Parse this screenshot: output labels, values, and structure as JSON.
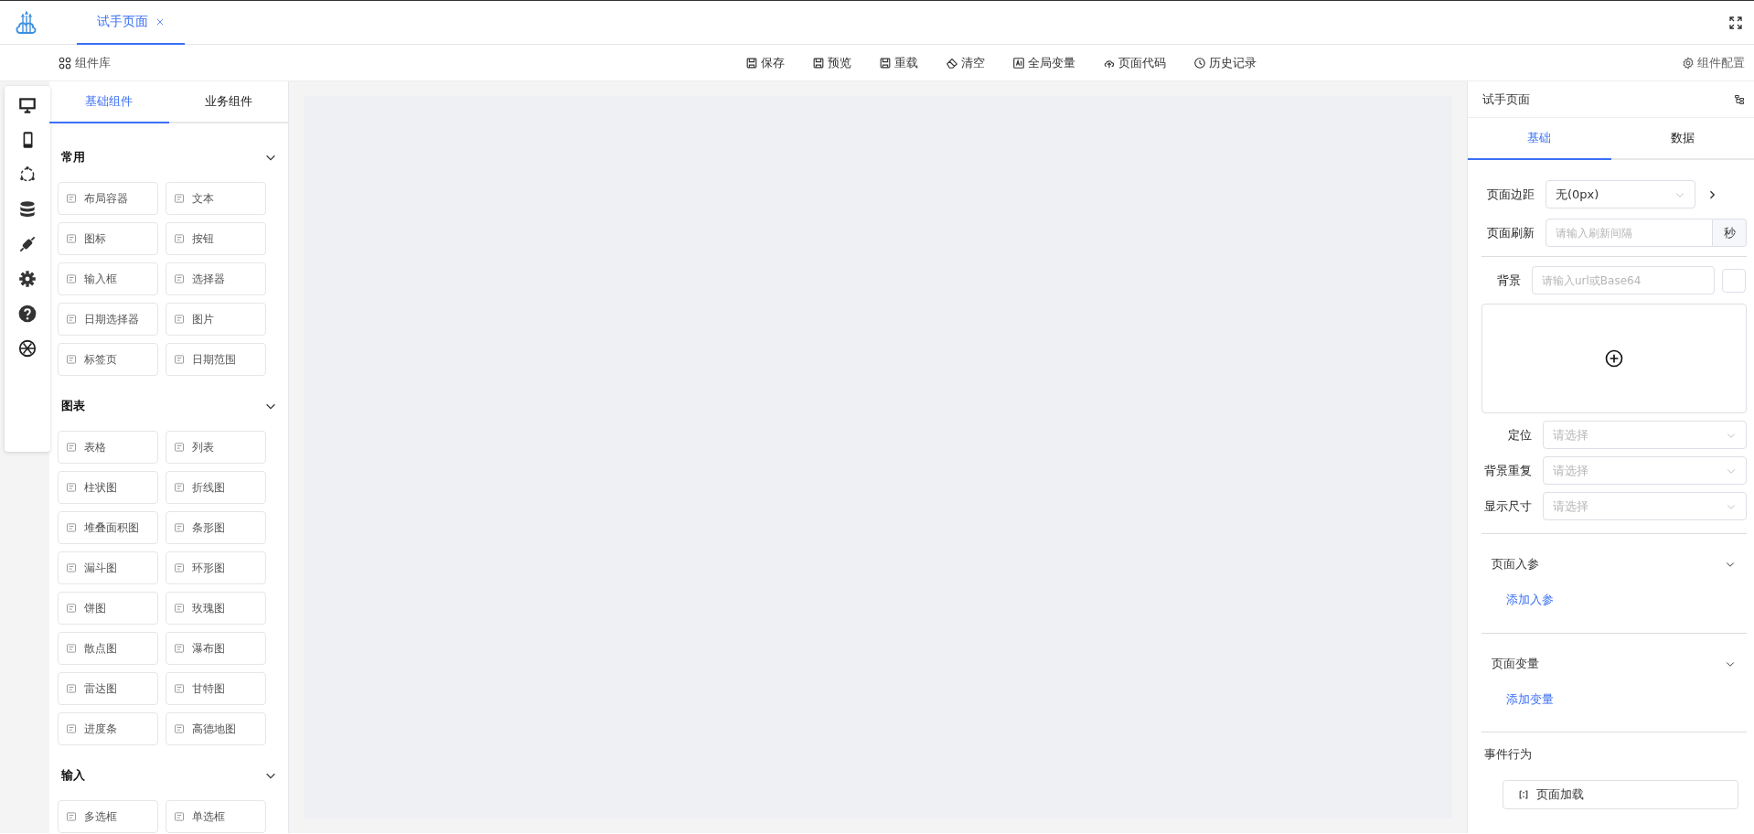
{
  "app_tabs": [
    {
      "label": "试手页面",
      "selected": true,
      "closable": true
    }
  ],
  "toolbar": {
    "library_label": "组件库",
    "actions": [
      {
        "label": "保存",
        "kind": "save"
      },
      {
        "label": "预览",
        "kind": "save"
      },
      {
        "label": "重载",
        "kind": "save"
      },
      {
        "label": "清空",
        "kind": "clear"
      },
      {
        "label": "全局变量",
        "kind": "variable"
      },
      {
        "label": "页面代码",
        "kind": "cloud"
      },
      {
        "label": "历史记录",
        "kind": "history"
      }
    ],
    "config_label": "组件配置"
  },
  "palette": {
    "tabs": [
      {
        "label": "基础组件",
        "selected": true
      },
      {
        "label": "业务组件",
        "selected": false
      }
    ],
    "groups": [
      {
        "title": "常用",
        "expanded": true,
        "items": [
          "布局容器",
          "文本",
          "图标",
          "按钮",
          "输入框",
          "选择器",
          "日期选择器",
          "图片",
          "标签页",
          "日期范围"
        ]
      },
      {
        "title": "图表",
        "expanded": true,
        "items": [
          "表格",
          "列表",
          "柱状图",
          "折线图",
          "堆叠面积图",
          "条形图",
          "漏斗图",
          "环形图",
          "饼图",
          "玫瑰图",
          "散点图",
          "瀑布图",
          "雷达图",
          "甘特图",
          "进度条",
          "高德地图"
        ]
      },
      {
        "title": "输入",
        "expanded": true,
        "items": [
          "多选框",
          "单选框"
        ]
      }
    ]
  },
  "properties": {
    "title": "试手页面",
    "tabs": [
      {
        "label": "基础",
        "selected": true
      },
      {
        "label": "数据",
        "selected": false
      }
    ],
    "margin": {
      "label": "页面边距",
      "value": "无(0px)"
    },
    "refresh": {
      "label": "页面刷新",
      "placeholder": "请输入刷新间隔",
      "unit": "秒"
    },
    "background": {
      "label": "背景",
      "placeholder": "请输入url或Base64"
    },
    "selects": [
      {
        "label": "定位",
        "placeholder": "请选择"
      },
      {
        "label": "背景重复",
        "placeholder": "请选择"
      },
      {
        "label": "显示尺寸",
        "placeholder": "请选择"
      }
    ],
    "sections": [
      {
        "title": "页面入参",
        "expanded": true,
        "link": "添加入参"
      },
      {
        "title": "页面变量",
        "expanded": true,
        "link": "添加变量"
      }
    ],
    "events": {
      "title": "事件行为",
      "items": [
        "页面加载"
      ]
    }
  }
}
